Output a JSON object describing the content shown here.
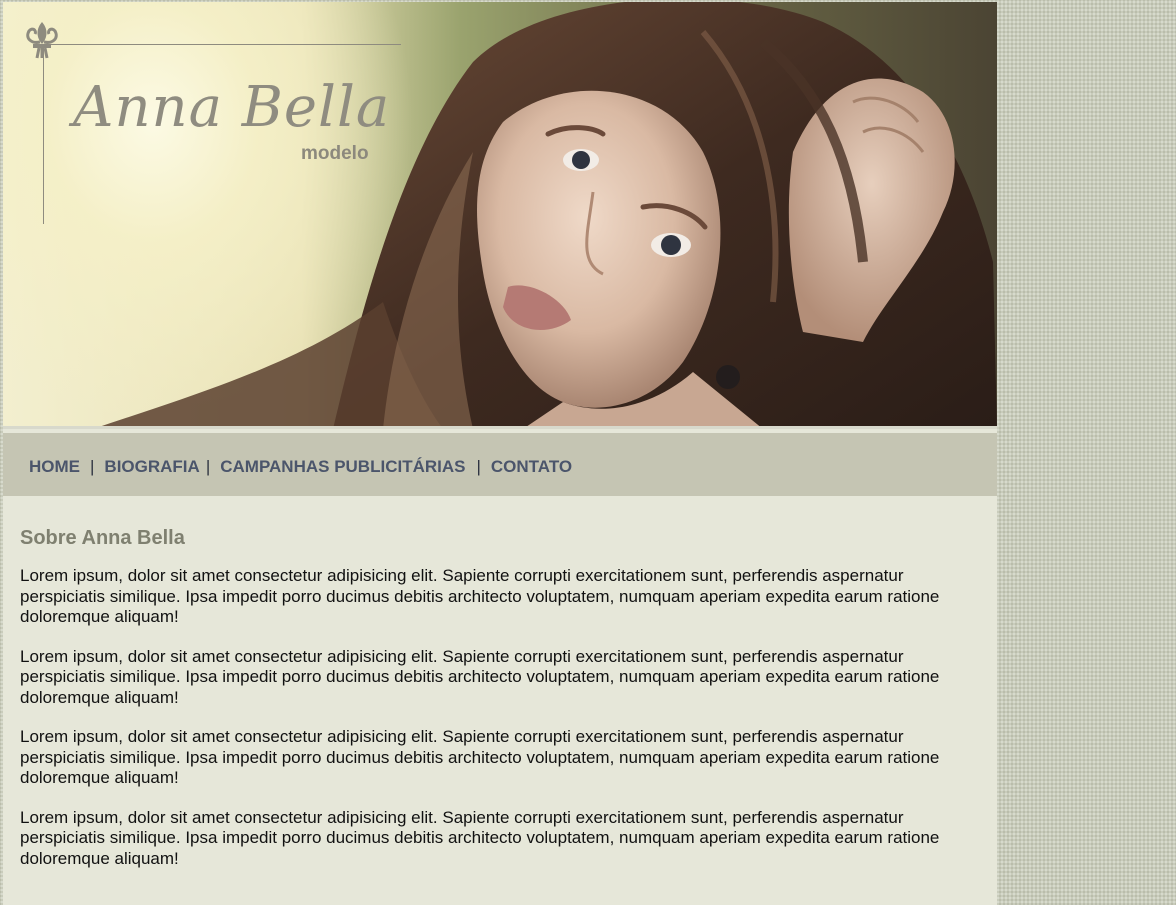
{
  "brand": {
    "name": "Anna Bella",
    "subtitle": "modelo"
  },
  "nav": {
    "items": [
      {
        "label": "HOME"
      },
      {
        "label": "BIOGRAFIA"
      },
      {
        "label": "CAMPANHAS PUBLICITÁRIAS"
      },
      {
        "label": "CONTATO"
      }
    ],
    "separator": "|"
  },
  "main": {
    "heading": "Sobre Anna Bella",
    "paragraphs": [
      "Lorem ipsum, dolor sit amet consectetur adipisicing elit. Sapiente corrupti exercitationem sunt, perferendis aspernatur perspiciatis similique. Ipsa impedit porro ducimus debitis architecto voluptatem, numquam aperiam expedita earum ratione doloremque aliquam!",
      "Lorem ipsum, dolor sit amet consectetur adipisicing elit. Sapiente corrupti exercitationem sunt, perferendis aspernatur perspiciatis similique. Ipsa impedit porro ducimus debitis architecto voluptatem, numquam aperiam expedita earum ratione doloremque aliquam!",
      "Lorem ipsum, dolor sit amet consectetur adipisicing elit. Sapiente corrupti exercitationem sunt, perferendis aspernatur perspiciatis similique. Ipsa impedit porro ducimus debitis architecto voluptatem, numquam aperiam expedita earum ratione doloremque aliquam!",
      "Lorem ipsum, dolor sit amet consectetur adipisicing elit. Sapiente corrupti exercitationem sunt, perferendis aspernatur perspiciatis similique. Ipsa impedit porro ducimus debitis architecto voluptatem, numquam aperiam expedita earum ratione doloremque aliquam!"
    ]
  },
  "icons": {
    "logo_ornament": "fleur-de-lis-icon"
  },
  "colors": {
    "nav_background": "#c5c5b3",
    "nav_text": "#4b556b",
    "content_background": "#e6e7d9",
    "heading": "#7f8070",
    "logo_text": "#8f8c80"
  }
}
